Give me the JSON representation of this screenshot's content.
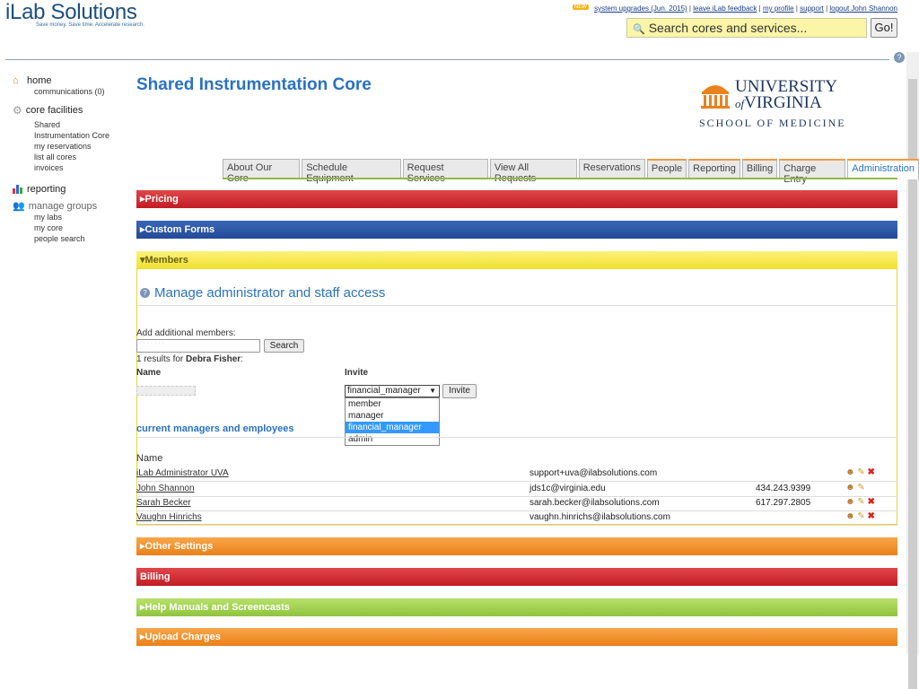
{
  "header": {
    "app_name": "iLab Solutions",
    "tagline": "Save money. Save time. Accelerate research.",
    "new_badge": "NEW",
    "top_links": [
      "system upgrades (Jun. 2015)",
      "leave iLab feedback",
      "my profile",
      "support",
      "logout John Shannon"
    ],
    "search_placeholder": "Search cores and services...",
    "go_label": "Go!"
  },
  "sidebar": {
    "home": "home",
    "home_items": [
      "communications (0)"
    ],
    "core_facilities": "core facilities",
    "core_items": [
      "Shared",
      "Instrumentation Core",
      "my reservations",
      "list all cores",
      "invoices"
    ],
    "reporting": "reporting",
    "manage_groups": "manage groups",
    "group_items": [
      "my labs",
      "my core",
      "people search"
    ]
  },
  "core": {
    "title": "Shared Instrumentation Core",
    "logo_line1": "UNIVERSITY",
    "logo_of": "of",
    "logo_line2": "VIRGINIA",
    "logo_school": "SCHOOL OF MEDICINE"
  },
  "tabs": [
    "About Our Core",
    "Schedule Equipment",
    "Request Services",
    "View All Requests",
    "Reservations",
    "People",
    "Reporting",
    "Billing",
    "Charge Entry",
    "Administration"
  ],
  "sections": {
    "pricing": "▸Pricing",
    "custom_forms": "▸Custom Forms",
    "members": "▾Members",
    "other_settings": "▸Other Settings",
    "billing": "Billing",
    "help": "▸Help Manuals and Screencasts",
    "upload": "▸Upload Charges"
  },
  "members": {
    "title": "Manage administrator and staff access",
    "add_label": "Add additional members:",
    "search_button": "Search",
    "results_prefix": "1 results for ",
    "results_name": "Debra Fisher",
    "results_suffix": ":",
    "col_name": "Name",
    "col_invite": "Invite",
    "select_value": "financial_manager",
    "invite_button": "Invite",
    "options": [
      "member",
      "manager",
      "financial_manager",
      "admin"
    ],
    "selected_option": "financial_manager",
    "current_heading": "current managers and employees",
    "list_col_name": "Name",
    "people": [
      {
        "name": "iLab Administrator UVA",
        "email": "support+uva@ilabsolutions.com",
        "phone": ""
      },
      {
        "name": "John Shannon",
        "email": "jds1c@virginia.edu",
        "phone": "434.243.9399"
      },
      {
        "name": "Sarah Becker",
        "email": "sarah.becker@ilabsolutions.com",
        "phone": "617.297.2805"
      },
      {
        "name": "Vaughn Hinrichs",
        "email": "vaughn.hinrichs@ilabsolutions.com",
        "phone": ""
      }
    ]
  },
  "colors": {
    "accent_blue": "#2a72c1",
    "bar_red": "#c21c24",
    "bar_blue": "#244a96",
    "bar_yellow": "#f1e12e",
    "bar_orange": "#eb8018",
    "bar_green": "#8fc43e"
  }
}
